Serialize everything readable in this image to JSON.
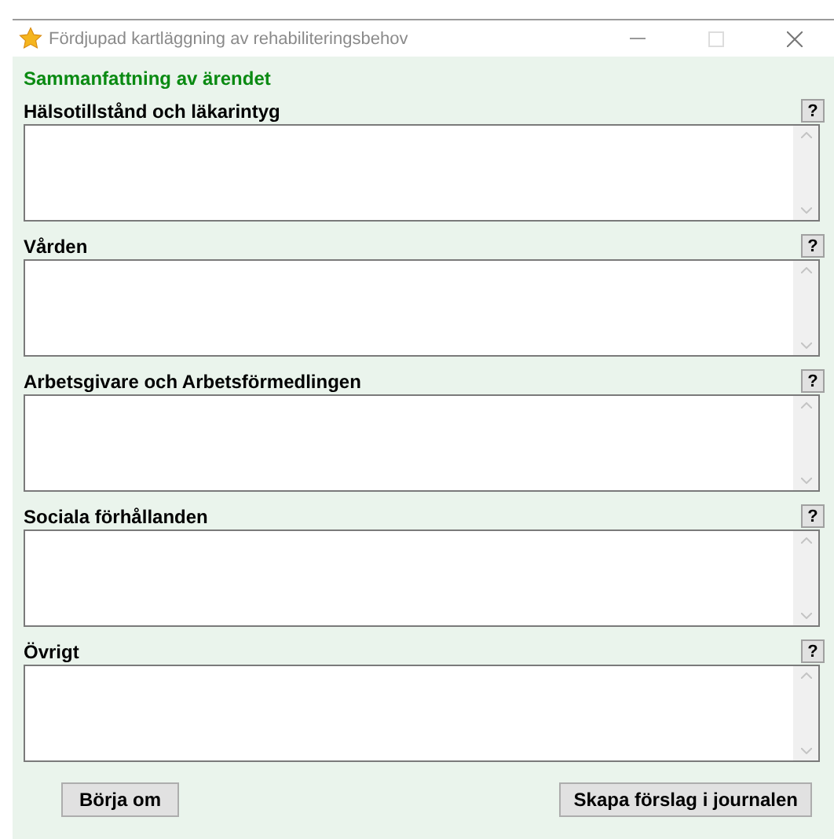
{
  "window": {
    "title": "Fördjupad kartläggning av rehabiliteringsbehov"
  },
  "heading": "Sammanfattning av ärendet",
  "sections": [
    {
      "label": "Hälsotillstånd och läkarintyg",
      "help": "?"
    },
    {
      "label": "Vården",
      "help": "?"
    },
    {
      "label": "Arbetsgivare och Arbetsförmedlingen",
      "help": "?"
    },
    {
      "label": "Sociala förhållanden",
      "help": "?"
    },
    {
      "label": "Övrigt",
      "help": "?"
    }
  ],
  "buttons": {
    "reset": "Börja om",
    "create": "Skapa förslag i journalen"
  }
}
